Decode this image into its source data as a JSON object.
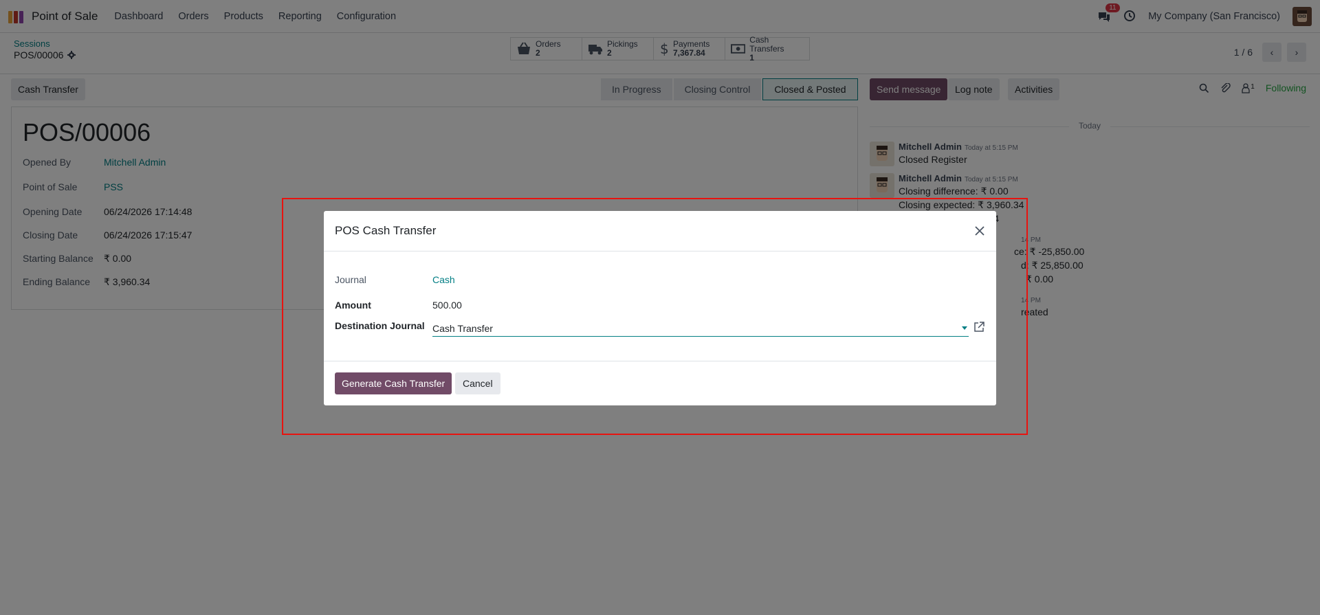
{
  "navbar": {
    "app_name": "Point of Sale",
    "menu": [
      "Dashboard",
      "Orders",
      "Products",
      "Reporting",
      "Configuration"
    ],
    "message_count": "11",
    "company": "My Company (San Francisco)"
  },
  "control": {
    "breadcrumb_parent": "Sessions",
    "breadcrumb_current": "POS/00006",
    "smart_buttons": [
      {
        "label": "Orders",
        "value": "2",
        "icon": "basket-icon"
      },
      {
        "label": "Pickings",
        "value": "2",
        "icon": "truck-icon"
      },
      {
        "label": "Payments",
        "value": "7,367.84",
        "icon": "dollar-icon"
      },
      {
        "label": "Cash Transfers",
        "value": "1",
        "icon": "money-icon"
      }
    ],
    "pager": "1 / 6"
  },
  "actions": {
    "cash_transfer": "Cash Transfer",
    "stages": [
      "In Progress",
      "Closing Control",
      "Closed & Posted"
    ],
    "active_stage": "Closed & Posted"
  },
  "form": {
    "title": "POS/00006",
    "fields": [
      {
        "label": "Opened By",
        "value": "Mitchell Admin",
        "link": true
      },
      {
        "label": "Point of Sale",
        "value": "PSS",
        "link": true
      },
      {
        "label": "Opening Date",
        "value": "06/24/2026 17:14:48",
        "link": false
      },
      {
        "label": "Closing Date",
        "value": "06/24/2026 17:15:47",
        "link": false
      },
      {
        "label": "Starting Balance",
        "value": "₹ 0.00",
        "link": false
      },
      {
        "label": "Ending Balance",
        "value": "₹ 3,960.34",
        "link": false
      }
    ]
  },
  "chatter": {
    "send_message": "Send message",
    "log_note": "Log note",
    "activities": "Activities",
    "follower_count": "1",
    "following": "Following",
    "today": "Today",
    "messages": [
      {
        "author": "Mitchell Admin",
        "time": "Today at 5:15 PM",
        "lines": [
          "Closed Register"
        ]
      },
      {
        "author": "Mitchell Admin",
        "time": "Today at 5:15 PM",
        "lines": [
          "Closing difference: ₹ 0.00",
          "Closing expected: ₹ 3,960.34",
          "60.34"
        ]
      },
      {
        "author": "",
        "time": "14 PM",
        "lines": [
          "ce: ₹ -25,850.00",
          "d: ₹ 25,850.00",
          "₹ 0.00"
        ]
      },
      {
        "author": "",
        "time": "14 PM",
        "lines": [
          "reated"
        ]
      }
    ]
  },
  "modal": {
    "title": "POS Cash Transfer",
    "journal_label": "Journal",
    "journal_value": "Cash",
    "amount_label": "Amount",
    "amount_value": "500.00",
    "dest_label": "Destination Journal",
    "dest_value": "Cash Transfer",
    "generate": "Generate Cash Transfer",
    "cancel": "Cancel"
  },
  "colors": {
    "brand": "#714b67",
    "link": "#017e84",
    "highlight": "#e8130f"
  }
}
